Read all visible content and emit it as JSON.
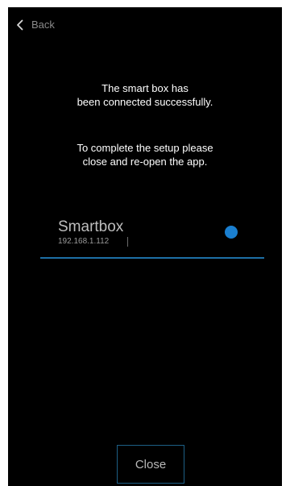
{
  "header": {
    "back_label": "Back",
    "back_icon": "chevron-left-icon"
  },
  "message": {
    "line1": "The smart box has",
    "line2": "been connected successfully.",
    "line3": "To complete the setup please",
    "line4": "close and re-open the app."
  },
  "device": {
    "name": "Smartbox",
    "ip": "192.168.1.112",
    "status_color": "#1a7fd0"
  },
  "footer": {
    "close_label": "Close"
  },
  "colors": {
    "background": "#000000",
    "accent": "#1d6fa5"
  }
}
